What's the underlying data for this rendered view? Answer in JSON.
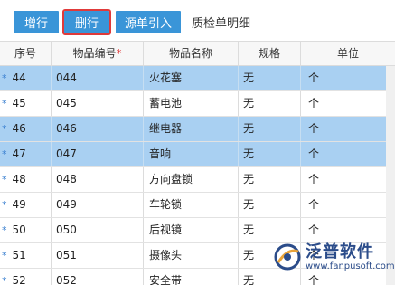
{
  "toolbar": {
    "add_label": "增行",
    "delete_label": "删行",
    "source_label": "源单引入",
    "title": "质检单明细"
  },
  "columns": {
    "seq": "序号",
    "code": "物品编号",
    "required_mark": "*",
    "name": "物品名称",
    "spec": "规格",
    "unit": "单位"
  },
  "rows": [
    {
      "seq": "44",
      "code": "044",
      "name": "火花塞",
      "spec": "无",
      "unit": "个",
      "selected": true
    },
    {
      "seq": "45",
      "code": "045",
      "name": "蓄电池",
      "spec": "无",
      "unit": "个",
      "selected": false
    },
    {
      "seq": "46",
      "code": "046",
      "name": "继电器",
      "spec": "无",
      "unit": "个",
      "selected": true
    },
    {
      "seq": "47",
      "code": "047",
      "name": "音响",
      "spec": "无",
      "unit": "个",
      "selected": true
    },
    {
      "seq": "48",
      "code": "048",
      "name": "方向盘锁",
      "spec": "无",
      "unit": "个",
      "selected": false
    },
    {
      "seq": "49",
      "code": "049",
      "name": "车轮锁",
      "spec": "无",
      "unit": "个",
      "selected": false
    },
    {
      "seq": "50",
      "code": "050",
      "name": "后视镜",
      "spec": "无",
      "unit": "个",
      "selected": false
    },
    {
      "seq": "51",
      "code": "051",
      "name": "摄像头",
      "spec": "无",
      "unit": "个",
      "selected": false
    },
    {
      "seq": "52",
      "code": "052",
      "name": "安全带",
      "spec": "无",
      "unit": "个",
      "selected": false
    }
  ],
  "row_marker": "*",
  "logo": {
    "name": "泛普软件",
    "url": "www.fanpusoft.com"
  },
  "colors": {
    "button": "#3a95d8",
    "selected_row": "#a9d0f2",
    "highlight_border": "#e03a3a"
  }
}
